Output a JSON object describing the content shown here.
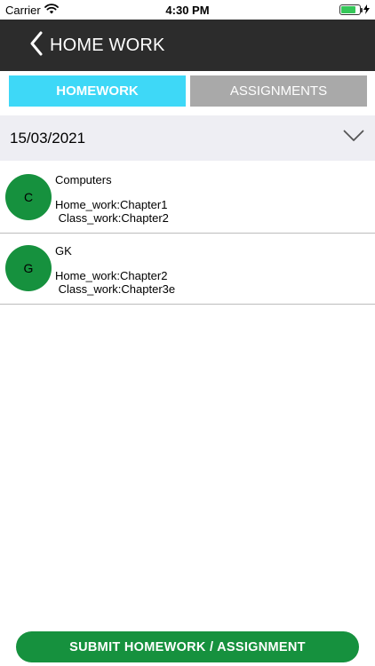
{
  "status_bar": {
    "carrier": "Carrier",
    "time": "4:30 PM"
  },
  "header": {
    "title": "HOME WORK"
  },
  "tabs": [
    {
      "label": "HOMEWORK",
      "active": true
    },
    {
      "label": "ASSIGNMENTS",
      "active": false
    }
  ],
  "date_selector": {
    "value": "15/03/2021"
  },
  "items": [
    {
      "initial": "C",
      "subject": "Computers",
      "home_work": "Home_work:Chapter1",
      "class_work": " Class_work:Chapter2"
    },
    {
      "initial": "G",
      "subject": "GK",
      "home_work": "Home_work:Chapter2",
      "class_work": " Class_work:Chapter3e"
    }
  ],
  "footer": {
    "submit_label": "SUBMIT HOMEWORK / ASSIGNMENT"
  },
  "colors": {
    "header_bg": "#2c2c2c",
    "tab_active": "#3ed8f7",
    "tab_inactive": "#a9a9a9",
    "accent_green": "#16913e",
    "date_bar_bg": "#eeeef3"
  },
  "icons": {
    "back": "chevron-left-icon",
    "dropdown": "chevron-down-icon",
    "wifi": "wifi-icon",
    "battery": "battery-icon",
    "charging": "bolt-icon"
  }
}
